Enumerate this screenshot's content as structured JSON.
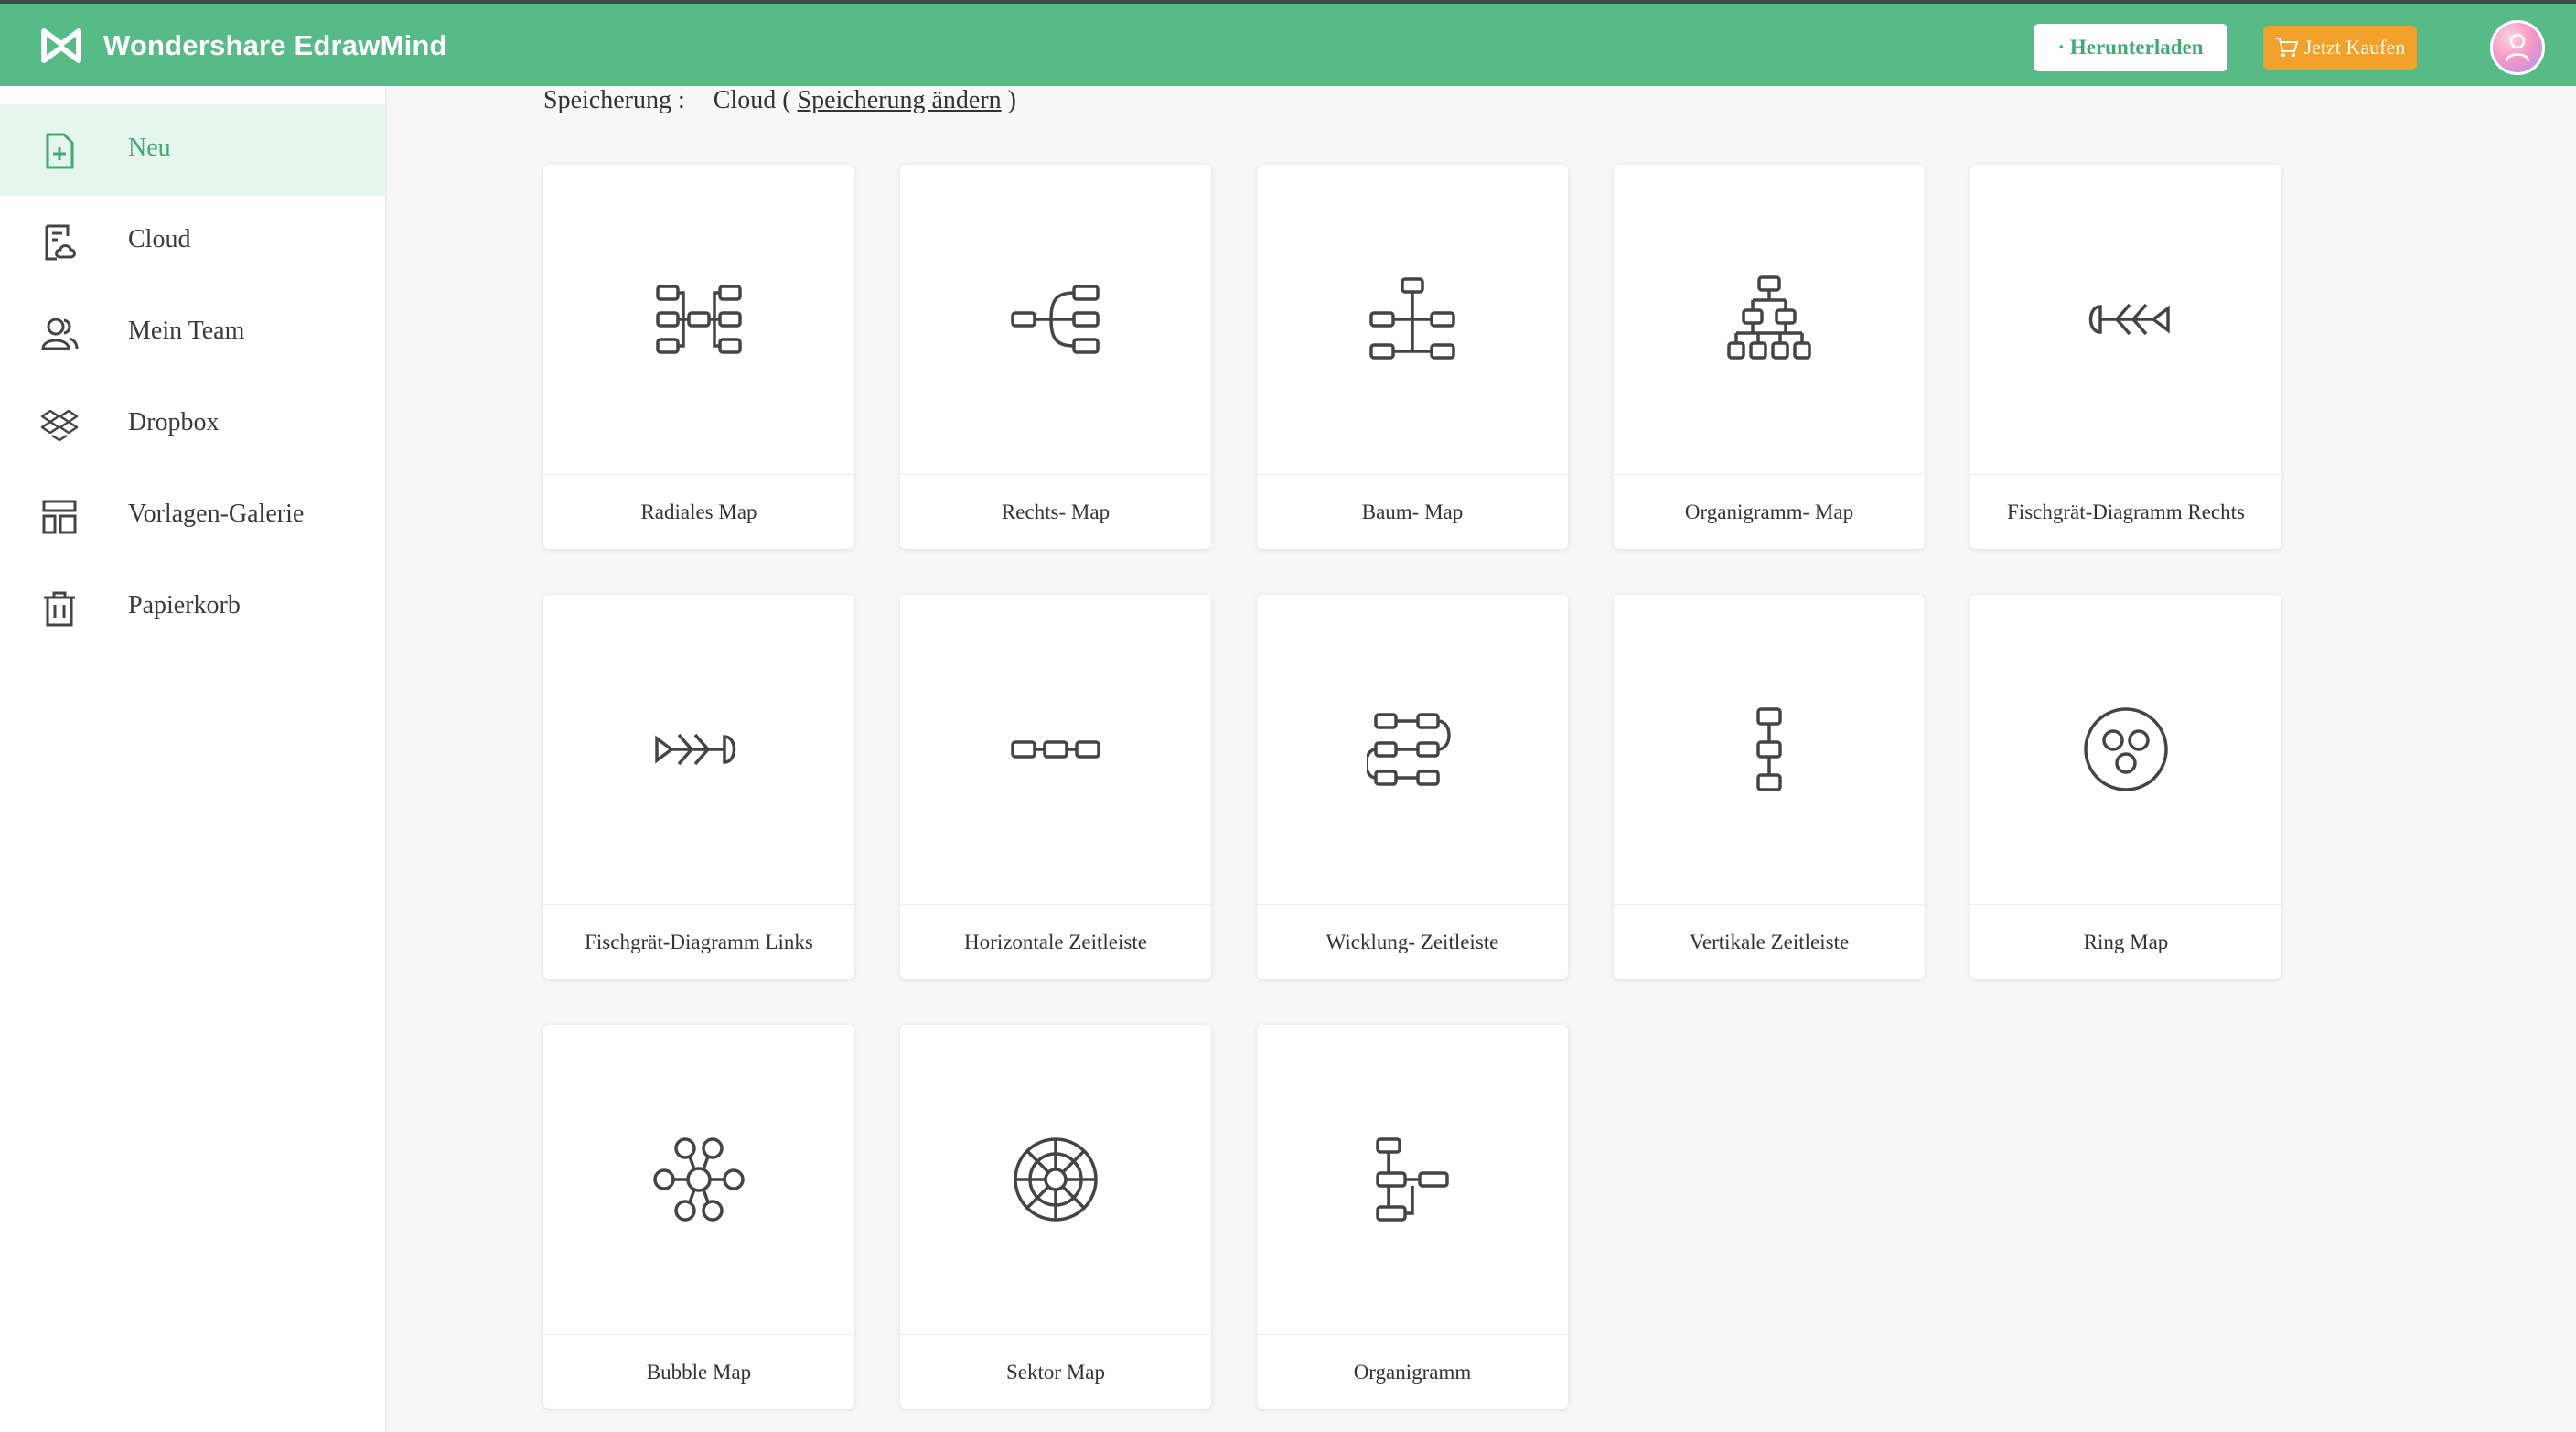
{
  "app": {
    "title": "Wondershare EdrawMind",
    "logo_icon": "edrawmind-logo-icon"
  },
  "header": {
    "download_label": "· Herunterladen",
    "buy_label": "Jetzt Kaufen",
    "buy_icon": "cart-icon",
    "avatar_icon": "user-avatar-icon",
    "accent_color": "#56bb87",
    "buy_color": "#f2a22b"
  },
  "sidebar": {
    "items": [
      {
        "label": "Neu",
        "icon": "new-file-icon",
        "active": true
      },
      {
        "label": "Cloud",
        "icon": "cloud-doc-icon",
        "active": false
      },
      {
        "label": "Mein Team",
        "icon": "team-icon",
        "active": false
      },
      {
        "label": "Dropbox",
        "icon": "dropbox-icon",
        "active": false
      },
      {
        "label": "Vorlagen-Galerie",
        "icon": "template-gallery-icon",
        "active": false
      },
      {
        "label": "Papierkorb",
        "icon": "trash-icon",
        "active": false
      }
    ]
  },
  "storage": {
    "label": "Speicherung :",
    "value_prefix": "Cloud (",
    "change_link": "Speicherung ändern",
    "value_suffix": ")"
  },
  "templates": [
    {
      "label": "Radiales Map",
      "icon": "radial-map-icon"
    },
    {
      "label": "Rechts- Map",
      "icon": "right-map-icon"
    },
    {
      "label": "Baum- Map",
      "icon": "tree-map-icon"
    },
    {
      "label": "Organigramm- Map",
      "icon": "org-chart-map-icon"
    },
    {
      "label": "Fischgrät-Diagramm Rechts",
      "icon": "fishbone-right-icon"
    },
    {
      "label": "Fischgrät-Diagramm Links",
      "icon": "fishbone-left-icon"
    },
    {
      "label": "Horizontale Zeitleiste",
      "icon": "horizontal-timeline-icon"
    },
    {
      "label": "Wicklung- Zeitleiste",
      "icon": "winding-timeline-icon"
    },
    {
      "label": "Vertikale Zeitleiste",
      "icon": "vertical-timeline-icon"
    },
    {
      "label": "Ring Map",
      "icon": "ring-map-icon"
    },
    {
      "label": "Bubble Map",
      "icon": "bubble-map-icon"
    },
    {
      "label": "Sektor Map",
      "icon": "sector-map-icon"
    },
    {
      "label": "Organigramm",
      "icon": "org-chart-icon"
    }
  ]
}
